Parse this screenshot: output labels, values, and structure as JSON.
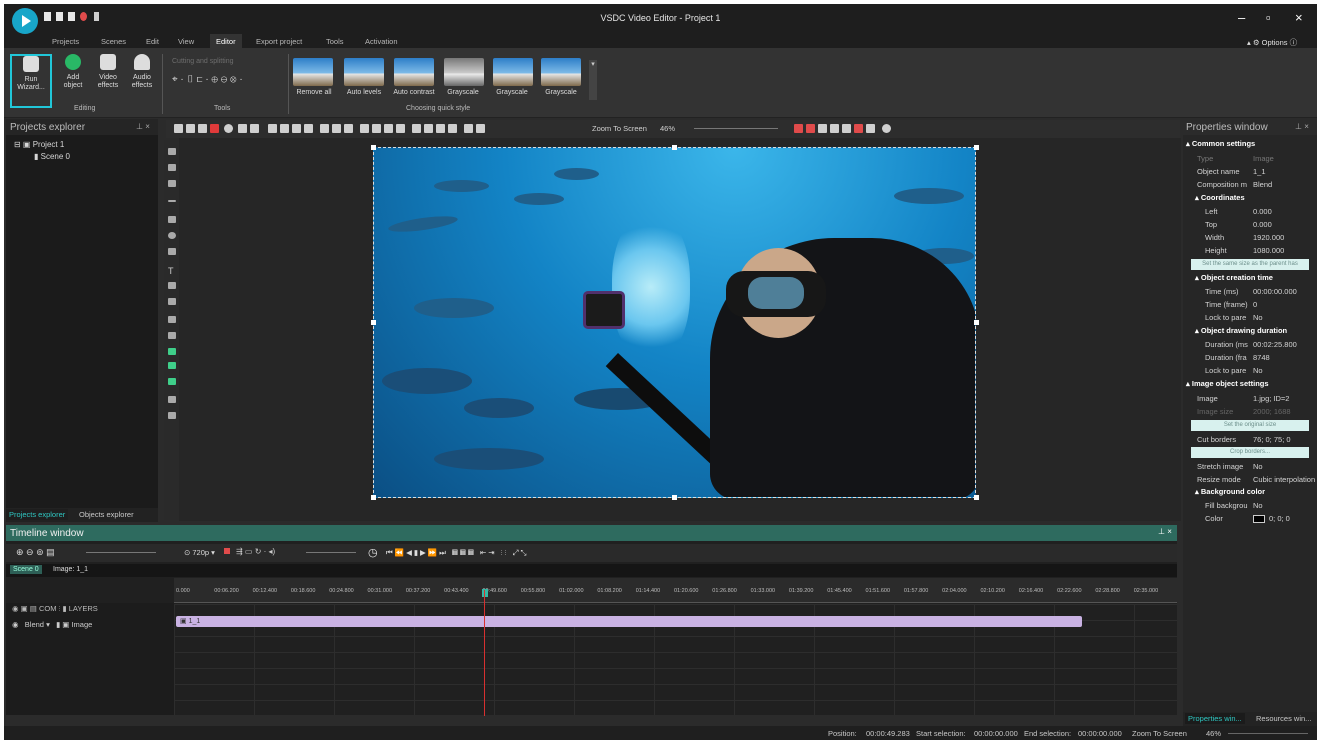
{
  "app": {
    "title": "VSDC Video Editor - Project 1",
    "options": "Options"
  },
  "menu": [
    "Projects",
    "Scenes",
    "Edit",
    "View",
    "Editor",
    "Export project",
    "Tools",
    "Activation"
  ],
  "ribbon": {
    "buttons": [
      "Run Wizard...",
      "Add object",
      "Video effects",
      "Audio effects"
    ],
    "group_editing": "Editing",
    "cut_split": "Cutting and splitting",
    "group_tools": "Tools",
    "styles": [
      "Remove all",
      "Auto levels",
      "Auto contrast",
      "Grayscale",
      "Grayscale",
      "Grayscale"
    ],
    "group_styles": "Choosing quick style"
  },
  "projects_explorer": {
    "title": "Projects explorer",
    "project": "Project 1",
    "scene": "Scene 0",
    "tabs": [
      "Projects explorer",
      "Objects explorer"
    ]
  },
  "canvas_toolbar": {
    "zoom_label": "Zoom To Screen",
    "zoom_value": "46%"
  },
  "properties": {
    "title": "Properties window",
    "common": "Common settings",
    "rows": [
      {
        "k": "Type",
        "v": "Image"
      },
      {
        "k": "Object name",
        "v": "1_1"
      },
      {
        "k": "Composition m",
        "v": "Blend"
      }
    ],
    "coordinates": "Coordinates",
    "coord_rows": [
      {
        "k": "Left",
        "v": "0.000"
      },
      {
        "k": "Top",
        "v": "0.000"
      },
      {
        "k": "Width",
        "v": "1920.000"
      },
      {
        "k": "Height",
        "v": "1080.000"
      }
    ],
    "same_size": "Set the same size as the parent has",
    "creation": "Object creation time",
    "creation_rows": [
      {
        "k": "Time (ms)",
        "v": "00:00:00.000"
      },
      {
        "k": "Time (frame)",
        "v": "0"
      },
      {
        "k": "Lock to pare",
        "v": "No"
      }
    ],
    "duration": "Object drawing duration",
    "duration_rows": [
      {
        "k": "Duration (ms",
        "v": "00:02:25.800"
      },
      {
        "k": "Duration (fra",
        "v": "8748"
      },
      {
        "k": "Lock to pare",
        "v": "No"
      }
    ],
    "image_settings": "Image object settings",
    "image_rows": [
      {
        "k": "Image",
        "v": "1.jpg; ID=2"
      },
      {
        "k": "Image size",
        "v": "2000; 1688"
      }
    ],
    "original_size": "Set the original size",
    "cut_borders": {
      "k": "Cut borders",
      "v": "76; 0; 75; 0"
    },
    "crop_borders": "Crop borders...",
    "more_rows": [
      {
        "k": "Stretch image",
        "v": "No"
      },
      {
        "k": "Resize mode",
        "v": "Cubic interpolation"
      }
    ],
    "bg": "Background color",
    "bg_rows": [
      {
        "k": "Fill backgrou",
        "v": "No"
      },
      {
        "k": "Color",
        "v": "0; 0; 0"
      }
    ],
    "tabs": [
      "Properties win...",
      "Resources win..."
    ]
  },
  "timeline": {
    "title": "Timeline window",
    "resolution": "720p",
    "scene_tabs": [
      "Scene 0",
      "Image: 1_1"
    ],
    "ruler": [
      "0.000",
      "00:06.200",
      "00:12.400",
      "00:18.600",
      "00:24.800",
      "00:31.000",
      "00:37.200",
      "00:43.400",
      "00:49.600",
      "00:55.800",
      "01:02.000",
      "01:08.200",
      "01:14.400",
      "01:20.600",
      "01:26.800",
      "01:33.000",
      "01:39.200",
      "01:45.400",
      "01:51.600",
      "01:57.800",
      "02:04.000",
      "02:10.200",
      "02:16.400",
      "02:22.600",
      "02:28.800",
      "02:35.000"
    ],
    "layer_header": "COM",
    "layers_label": "LAYERS",
    "blend": "Blend",
    "track_type": "Image",
    "clip": "1_1"
  },
  "status": {
    "position_label": "Position:",
    "position": "00:00:49.283",
    "start_label": "Start selection:",
    "start": "00:00:00.000",
    "end_label": "End selection:",
    "end": "00:00:00.000",
    "zoom_label": "Zoom To Screen",
    "zoom": "46%"
  },
  "colors": {
    "accent": "#21c7d9",
    "timeline_header": "#2e6b5f",
    "clip": "#c9b2e3"
  }
}
